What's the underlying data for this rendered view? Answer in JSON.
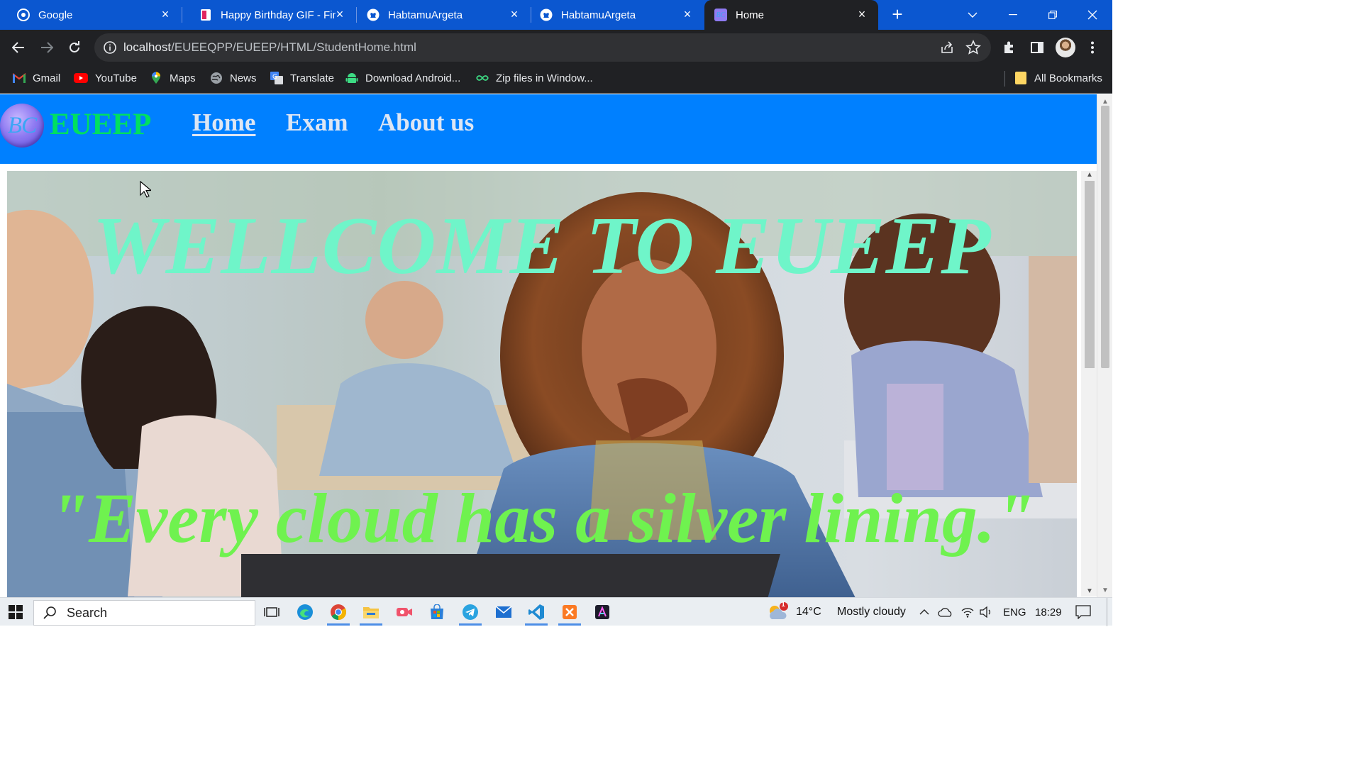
{
  "browser": {
    "tabs": [
      {
        "title": "Google",
        "icon": "google-icon"
      },
      {
        "title": "Happy Birthday GIF - Find",
        "icon": "gif-icon"
      },
      {
        "title": "HabtamuArgeta",
        "icon": "github-icon"
      },
      {
        "title": "HabtamuArgeta",
        "icon": "github-icon"
      },
      {
        "title": "Home",
        "icon": "site-favicon",
        "active": true
      }
    ],
    "url_host": "localhost",
    "url_path": "/EUEEQPP/EUEEP/HTML/StudentHome.html",
    "bookmarks": [
      {
        "label": "Gmail",
        "icon": "gmail-icon"
      },
      {
        "label": "YouTube",
        "icon": "youtube-icon"
      },
      {
        "label": "Maps",
        "icon": "maps-icon"
      },
      {
        "label": "News",
        "icon": "news-icon"
      },
      {
        "label": "Translate",
        "icon": "translate-icon"
      },
      {
        "label": "Download Android...",
        "icon": "android-icon"
      },
      {
        "label": "Zip files in Window...",
        "icon": "link-icon"
      }
    ],
    "all_bookmarks": "All Bookmarks"
  },
  "site": {
    "logo_text": "BC",
    "brand": "EUEEP",
    "nav": [
      {
        "label": "Home",
        "current": true
      },
      {
        "label": "Exam"
      },
      {
        "label": "About us"
      }
    ],
    "hero_title": "WELLCOME TO EUEEP",
    "hero_quote": "\"Every cloud has a silver lining.\""
  },
  "taskbar": {
    "search_label": "Search",
    "weather_temp": "14°C",
    "weather_desc": "Mostly cloudy",
    "weather_badge": "1",
    "language": "ENG",
    "time": "18:29"
  },
  "colors": {
    "tabstrip": "#0b57d0",
    "site_nav": "#0080ff",
    "brand": "#00e060",
    "hero_title": "#6ff5c9",
    "hero_quote": "#6ff24f"
  }
}
